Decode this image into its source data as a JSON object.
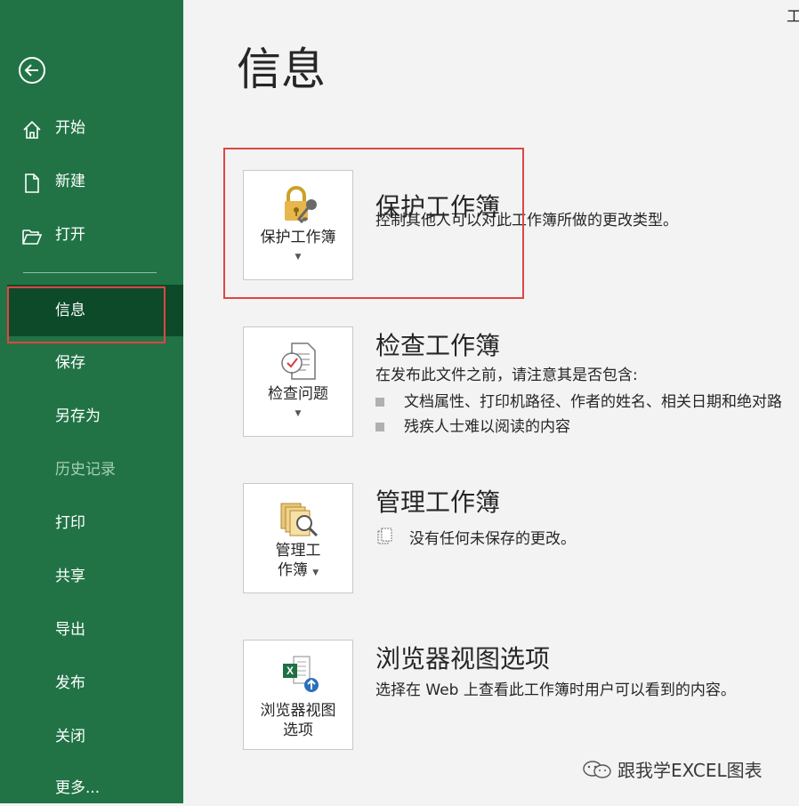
{
  "sidebar": {
    "items": [
      {
        "label": "开始",
        "icon": "home-icon"
      },
      {
        "label": "新建",
        "icon": "new-file-icon"
      },
      {
        "label": "打开",
        "icon": "open-folder-icon"
      },
      {
        "label": "信息",
        "state": "selected"
      },
      {
        "label": "保存"
      },
      {
        "label": "另存为"
      },
      {
        "label": "历史记录",
        "state": "disabled"
      },
      {
        "label": "打印"
      },
      {
        "label": "共享"
      },
      {
        "label": "导出"
      },
      {
        "label": "发布"
      },
      {
        "label": "关闭"
      },
      {
        "label": "更多..."
      }
    ]
  },
  "page": {
    "title": "信息",
    "corner_text": "工"
  },
  "sections": [
    {
      "tile_label": "保护工作簿",
      "title": "保护工作簿",
      "desc": "控制其他人可以对此工作簿所做的更改类型。",
      "icon": "lock-key-icon"
    },
    {
      "tile_label": "检查问题",
      "title": "检查工作簿",
      "desc": "在发布此文件之前，请注意其是否包含:",
      "bullets": [
        "文档属性、打印机路径、作者的姓名、相关日期和绝对路",
        "残疾人士难以阅读的内容"
      ],
      "icon": "inspect-document-icon"
    },
    {
      "tile_label_line1": "管理工",
      "tile_label_line2": "作簿",
      "title": "管理工作簿",
      "desc": "没有任何未保存的更改。",
      "icon": "manage-workbook-icon"
    },
    {
      "tile_label_line1": "浏览器视图",
      "tile_label_line2": "选项",
      "title": "浏览器视图选项",
      "desc": "选择在 Web 上查看此工作簿时用户可以看到的内容。",
      "icon": "browser-view-icon"
    }
  ],
  "watermark": "跟我学EXCEL图表",
  "colors": {
    "sidebar": "#217346",
    "selected": "#0d4a2a",
    "highlight": "#e04545",
    "background": "#f3f3f3"
  }
}
